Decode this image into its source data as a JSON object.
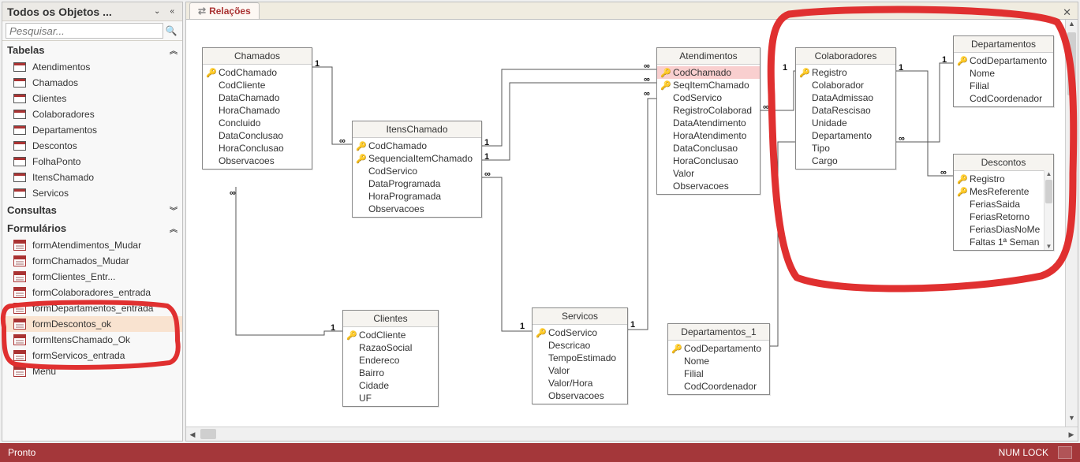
{
  "nav": {
    "title": "Todos os Objetos ...",
    "search_placeholder": "Pesquisar...",
    "sections": {
      "tables_label": "Tabelas",
      "queries_label": "Consultas",
      "forms_label": "Formulários"
    },
    "tables": [
      "Atendimentos",
      "Chamados",
      "Clientes",
      "Colaboradores",
      "Departamentos",
      "Descontos",
      "FolhaPonto",
      "ItensChamado",
      "Servicos"
    ],
    "forms": [
      "formAtendimentos_Mudar",
      "formChamados_Mudar",
      "formClientes_Entr...",
      "formColaboradores_entrada",
      "formDepartamentos_entrada",
      "formDescontos_ok",
      "formItensChamado_Ok",
      "formServicos_entrada",
      "Menu"
    ],
    "selected_form": "formDescontos_ok"
  },
  "tab": {
    "label": "Relações"
  },
  "status": {
    "ready": "Pronto",
    "numlock": "NUM LOCK"
  },
  "tables": {
    "Chamados": {
      "title": "Chamados",
      "fields": [
        {
          "k": true,
          "n": "CodChamado"
        },
        {
          "n": "CodCliente"
        },
        {
          "n": "DataChamado"
        },
        {
          "n": "HoraChamado"
        },
        {
          "n": "Concluido"
        },
        {
          "n": "DataConclusao"
        },
        {
          "n": "HoraConclusao"
        },
        {
          "n": "Observacoes"
        }
      ]
    },
    "ItensChamado": {
      "title": "ItensChamado",
      "fields": [
        {
          "k": true,
          "n": "CodChamado"
        },
        {
          "k": true,
          "n": "SequenciaItemChamado"
        },
        {
          "n": "CodServico"
        },
        {
          "n": "DataProgramada"
        },
        {
          "n": "HoraProgramada"
        },
        {
          "n": "Observacoes"
        }
      ]
    },
    "Atendimentos": {
      "title": "Atendimentos",
      "fields": [
        {
          "k": true,
          "n": "CodChamado",
          "sel": true
        },
        {
          "k": true,
          "n": "SeqItemChamado"
        },
        {
          "n": "CodServico"
        },
        {
          "n": "RegistroColaborad"
        },
        {
          "n": "DataAtendimento"
        },
        {
          "n": "HoraAtendimento"
        },
        {
          "n": "DataConclusao"
        },
        {
          "n": "HoraConclusao"
        },
        {
          "n": "Valor"
        },
        {
          "n": "Observacoes"
        }
      ]
    },
    "Colaboradores": {
      "title": "Colaboradores",
      "fields": [
        {
          "k": true,
          "n": "Registro"
        },
        {
          "n": "Colaborador"
        },
        {
          "n": "DataAdmissao"
        },
        {
          "n": "DataRescisao"
        },
        {
          "n": "Unidade"
        },
        {
          "n": "Departamento"
        },
        {
          "n": "Tipo"
        },
        {
          "n": "Cargo"
        }
      ]
    },
    "Departamentos": {
      "title": "Departamentos",
      "fields": [
        {
          "k": true,
          "n": "CodDepartamento"
        },
        {
          "n": "Nome"
        },
        {
          "n": "Filial"
        },
        {
          "n": "CodCoordenador"
        }
      ]
    },
    "Descontos": {
      "title": "Descontos",
      "fields": [
        {
          "k": true,
          "n": "Registro"
        },
        {
          "k": true,
          "n": "MesReferente"
        },
        {
          "n": "FeriasSaida"
        },
        {
          "n": "FeriasRetorno"
        },
        {
          "n": "FeriasDiasNoMe"
        },
        {
          "n": "Faltas 1ª Seman"
        }
      ],
      "scroll": true
    },
    "Clientes": {
      "title": "Clientes",
      "fields": [
        {
          "k": true,
          "n": "CodCliente"
        },
        {
          "n": "RazaoSocial"
        },
        {
          "n": "Endereco"
        },
        {
          "n": "Bairro"
        },
        {
          "n": "Cidade"
        },
        {
          "n": "UF"
        }
      ]
    },
    "Servicos": {
      "title": "Servicos",
      "fields": [
        {
          "k": true,
          "n": "CodServico"
        },
        {
          "n": "Descricao"
        },
        {
          "n": "TempoEstimado"
        },
        {
          "n": "Valor"
        },
        {
          "n": "Valor/Hora"
        },
        {
          "n": "Observacoes"
        }
      ]
    },
    "Departamentos_1": {
      "title": "Departamentos_1",
      "fields": [
        {
          "k": true,
          "n": "CodDepartamento"
        },
        {
          "n": "Nome"
        },
        {
          "n": "Filial"
        },
        {
          "n": "CodCoordenador"
        }
      ]
    }
  },
  "labels": {
    "one": "1",
    "many": "∞"
  }
}
